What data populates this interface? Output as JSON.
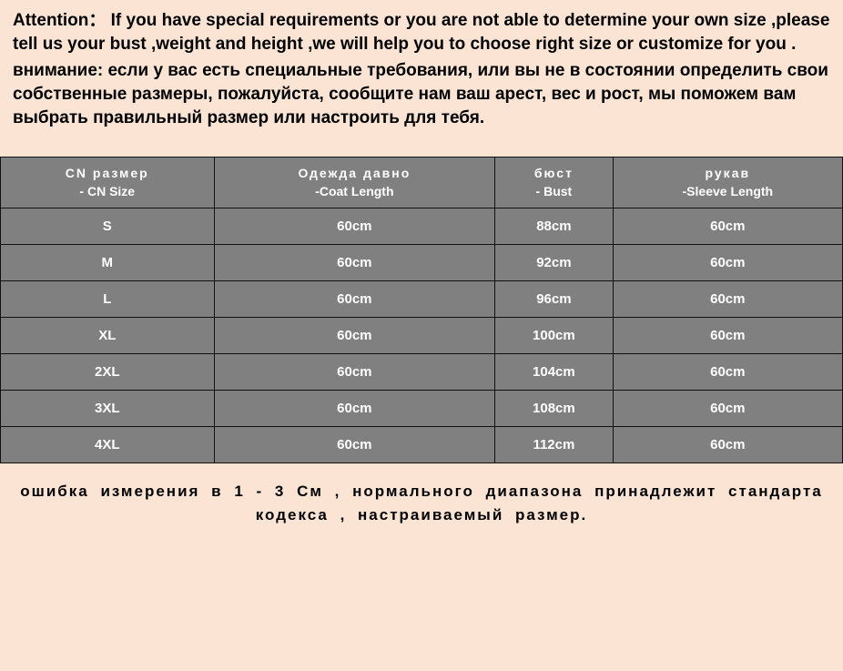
{
  "header": {
    "en1": "Attention： If you have special requirements or you are not able to determine your own size ,please tell us your bust ,weight and height ,we will help you to choose right size or customize for you .",
    "ru1": "внимание: если у вас есть специальные требования, или вы не в состоянии определить свои собственные размеры, пожалуйста, сообщите нам ваш арест, вес и рост, мы поможем вам выбрать правильный размер или настроить для тебя."
  },
  "table": {
    "headers": [
      {
        "top": "CN размер",
        "bottom": "- CN Size"
      },
      {
        "top": "Одежда давно",
        "bottom": "-Coat Length"
      },
      {
        "top": "бюст",
        "bottom": "- Bust"
      },
      {
        "top": "рукав",
        "bottom": "-Sleeve Length"
      }
    ],
    "rows": [
      {
        "size": "S",
        "coat": "60cm",
        "bust": "88cm",
        "sleeve": "60cm"
      },
      {
        "size": "M",
        "coat": "60cm",
        "bust": "92cm",
        "sleeve": "60cm"
      },
      {
        "size": "L",
        "coat": "60cm",
        "bust": "96cm",
        "sleeve": "60cm"
      },
      {
        "size": "XL",
        "coat": "60cm",
        "bust": "100cm",
        "sleeve": "60cm"
      },
      {
        "size": "2XL",
        "coat": "60cm",
        "bust": "104cm",
        "sleeve": "60cm"
      },
      {
        "size": "3XL",
        "coat": "60cm",
        "bust": "108cm",
        "sleeve": "60cm"
      },
      {
        "size": "4XL",
        "coat": "60cm",
        "bust": "112cm",
        "sleeve": "60cm"
      }
    ]
  },
  "footer": {
    "note": "ошибка измерения в 1 - 3 См , нормального диапазона принадлежит стандарта кодекса , настраиваемый размер."
  }
}
